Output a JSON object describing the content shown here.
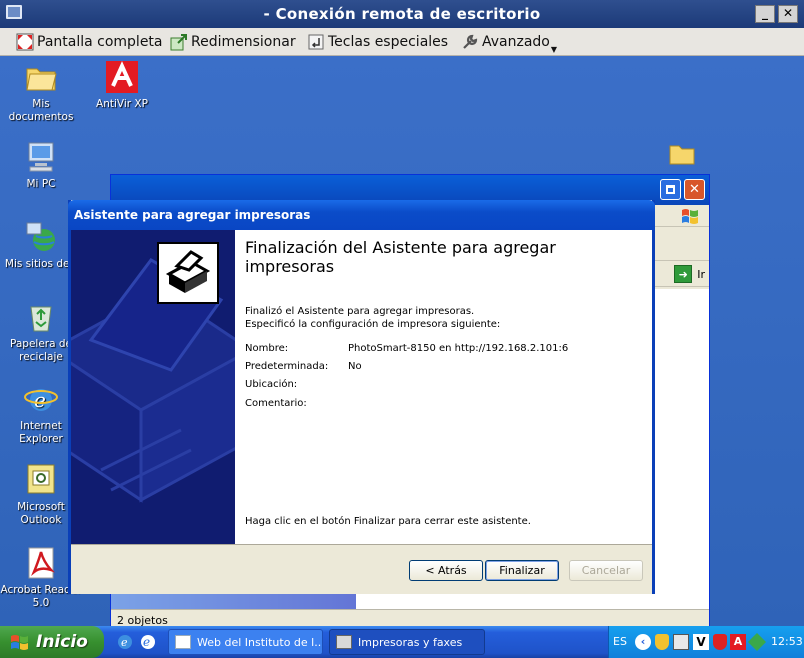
{
  "remote_window": {
    "title": "- Conexión remota de escritorio",
    "minimize": "_",
    "maximize": "□",
    "close": "✕"
  },
  "toolbar": {
    "fullscreen_label": "Pantalla completa",
    "resize_label": "Redimensionar",
    "special_keys_label": "Teclas especiales",
    "advanced_label": "Avanzado"
  },
  "desktop_icons": {
    "my_documents": "Mis documentos",
    "antivir": "AntiVir XP",
    "my_pc": "Mi PC",
    "network": "Mis sitios de r",
    "recycle_bin": "Papelera de reciclaje",
    "ie": "Internet Explorer",
    "outlook": "Microsoft Outlook",
    "acrobat": "Acrobat Reader 5.0"
  },
  "explorer": {
    "go_label": "Ir",
    "status": "2 objetos"
  },
  "wizard": {
    "title": "Asistente para agregar impresoras",
    "heading": "Finalización del Asistente para agregar impresoras",
    "line1": "Finalizó el Asistente para agregar impresoras.",
    "line2": "Especificó la configuración de impresora siguiente:",
    "fields": [
      {
        "label": "Nombre:",
        "value": "PhotoSmart-8150 en http://192.168.2.101:6"
      },
      {
        "label": "Predeterminada:",
        "value": "No"
      },
      {
        "label": "Ubicación:",
        "value": ""
      },
      {
        "label": "Comentario:",
        "value": ""
      }
    ],
    "footer_note": "Haga clic en el botón Finalizar para cerrar este asistente.",
    "back_label": "< Atrás",
    "finish_label": "Finalizar",
    "cancel_label": "Cancelar"
  },
  "taskbar": {
    "start_label": "Inicio",
    "task1": "Web del Instituto de l...",
    "task2": "Impresoras y faxes",
    "lang": "ES",
    "clock": "12:53"
  }
}
